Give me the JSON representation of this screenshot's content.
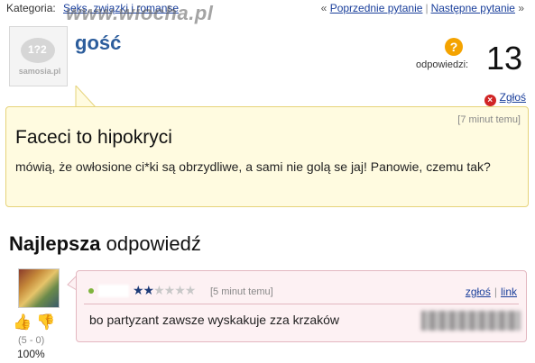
{
  "breadcrumb": {
    "label": "Kategoria:",
    "category": "Seks, związki i romanse"
  },
  "nav": {
    "prev_arrow": "«",
    "prev": "Poprzednie pytanie",
    "separator": "|",
    "next": "Następne pytanie",
    "next_arrow": "»"
  },
  "watermark": "www.wiocha.pl",
  "avatar": {
    "logo_text": "1?2",
    "brand": "samosia.pl"
  },
  "asker": {
    "name": "gość"
  },
  "answers_counter": {
    "icon": "?",
    "label": "odpowiedzi:",
    "count": "13"
  },
  "report": {
    "icon": "×",
    "label": "Zgłoś"
  },
  "question": {
    "time": "[7 minut temu]",
    "title": "Faceci to hipokryci",
    "body": "mówią, że owłosione ci*ki są obrzydliwe, a sami nie golą se jaj! Panowie, czemu tak?"
  },
  "best_answer": {
    "title_bold": "Najlepsza",
    "title_rest": "odpowiedź",
    "rating_on": "★★",
    "rating_off": "★★★★",
    "time": "[5 minut temu]",
    "report_link": "zgłoś",
    "link": "link",
    "link_sep": "|",
    "text": "bo partyzant zawsze wyskakuje zza krzaków",
    "votes": "(5 - 0)",
    "percent": "100%",
    "thumb_up": "👍",
    "thumb_down": "👎"
  },
  "colors": {
    "link": "#1a3f9b",
    "asker_name": "#2c5d9c",
    "question_bg": "#fffbe0",
    "answer_bg": "#fdf1f3",
    "report_icon": "#d12525",
    "question_icon": "#f4a300"
  }
}
